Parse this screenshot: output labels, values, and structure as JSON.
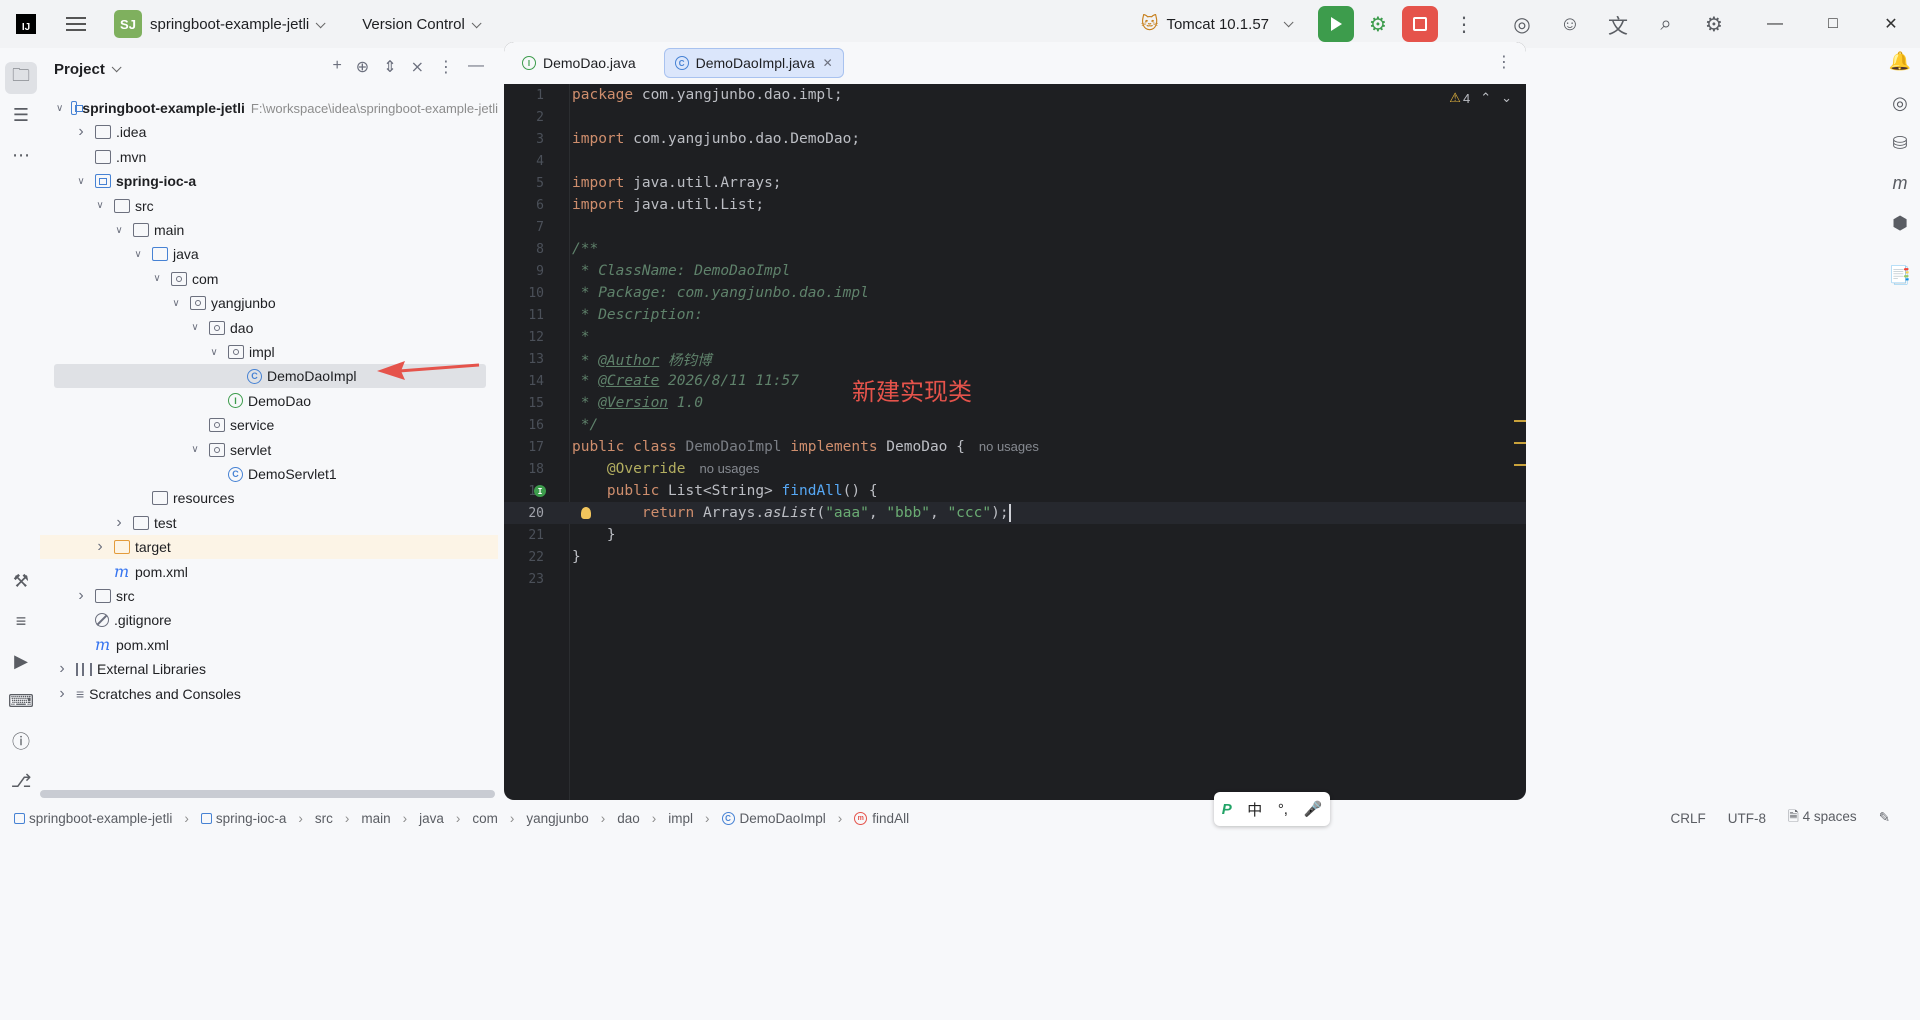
{
  "titlebar": {
    "logo": "IJ",
    "project_badge": "SJ",
    "project_name": "springboot-example-jetli",
    "vcs": "Version Control",
    "run_config": "Tomcat 10.1.57"
  },
  "project_panel": {
    "title": "Project",
    "tree": [
      {
        "label": "springboot-example-jetli",
        "hint": "F:\\workspace\\idea\\springboot-example-jetli",
        "depth": 0,
        "icon": "module",
        "toggle": "open",
        "bold": true
      },
      {
        "label": ".idea",
        "depth": 1,
        "icon": "folder",
        "toggle": "closed"
      },
      {
        "label": ".mvn",
        "depth": 1,
        "icon": "folder",
        "toggle": ""
      },
      {
        "label": "spring-ioc-a",
        "depth": 1,
        "icon": "module",
        "toggle": "open",
        "bold": true
      },
      {
        "label": "src",
        "depth": 2,
        "icon": "folder",
        "toggle": "open"
      },
      {
        "label": "main",
        "depth": 3,
        "icon": "folder",
        "toggle": "open"
      },
      {
        "label": "java",
        "depth": 4,
        "icon": "folder-blue",
        "toggle": "open"
      },
      {
        "label": "com",
        "depth": 5,
        "icon": "pkg",
        "toggle": "open"
      },
      {
        "label": "yangjunbo",
        "depth": 6,
        "icon": "pkg",
        "toggle": "open"
      },
      {
        "label": "dao",
        "depth": 7,
        "icon": "pkg",
        "toggle": "open"
      },
      {
        "label": "impl",
        "depth": 8,
        "icon": "pkg",
        "toggle": "open"
      },
      {
        "label": "DemoDaoImpl",
        "depth": 9,
        "icon": "class",
        "toggle": "",
        "selected": true
      },
      {
        "label": "DemoDao",
        "depth": 8,
        "icon": "interface",
        "toggle": ""
      },
      {
        "label": "service",
        "depth": 7,
        "icon": "pkg",
        "toggle": ""
      },
      {
        "label": "servlet",
        "depth": 7,
        "icon": "pkg",
        "toggle": "open"
      },
      {
        "label": "DemoServlet1",
        "depth": 8,
        "icon": "class",
        "toggle": ""
      },
      {
        "label": "resources",
        "depth": 4,
        "icon": "folder",
        "toggle": ""
      },
      {
        "label": "test",
        "depth": 3,
        "icon": "folder",
        "toggle": "closed"
      },
      {
        "label": "target",
        "depth": 2,
        "icon": "folder-orange",
        "toggle": "closed",
        "target": true
      },
      {
        "label": "pom.xml",
        "depth": 2,
        "icon": "maven",
        "toggle": ""
      },
      {
        "label": "src",
        "depth": 1,
        "icon": "folder",
        "toggle": "closed"
      },
      {
        "label": ".gitignore",
        "depth": 1,
        "icon": "ignore",
        "toggle": ""
      },
      {
        "label": "pom.xml",
        "depth": 1,
        "icon": "maven",
        "toggle": ""
      },
      {
        "label": "External Libraries",
        "depth": 0,
        "icon": "library",
        "toggle": "closed"
      },
      {
        "label": "Scratches and Consoles",
        "depth": 0,
        "icon": "scratch",
        "toggle": "closed"
      }
    ]
  },
  "editor": {
    "tabs": [
      {
        "label": "DemoDao.java",
        "icon": "I",
        "active": false
      },
      {
        "label": "DemoDaoImpl.java",
        "icon": "C",
        "active": true
      }
    ],
    "warnings": "4",
    "current_line": 20,
    "annotation": "新建实现类",
    "lines": {
      "l1": [
        "package",
        " com.yangjunbo.dao.impl;"
      ],
      "l3": [
        "import",
        " com.yangjunbo.dao.DemoDao;"
      ],
      "l5": [
        "import",
        " java.util.Arrays;"
      ],
      "l6": [
        "import",
        " java.util.List;"
      ],
      "l8": "/**",
      "l9": " * ClassName: DemoDaoImpl",
      "l10": " * Package: com.yangjunbo.dao.impl",
      "l11": " * Description:",
      "l12": " *",
      "l13": [
        " * ",
        "@Author",
        " 杨钧博"
      ],
      "l14": [
        " * ",
        "@Create",
        " 2026/8/11 11:57"
      ],
      "l15": [
        " * ",
        "@Version",
        " 1.0"
      ],
      "l16": " */",
      "l17": [
        "public class ",
        "DemoDaoImpl",
        " implements ",
        "DemoDao {",
        "no usages"
      ],
      "l18": [
        "    @Override",
        "no usages"
      ],
      "l19": [
        "    public ",
        "List<String> ",
        "findAll",
        "() {"
      ],
      "l20": [
        "        return ",
        "Arrays.",
        "asList",
        "(",
        "\"aaa\"",
        ", ",
        "\"bbb\"",
        ", ",
        "\"ccc\"",
        ");"
      ],
      "l21": "    }",
      "l22": "}"
    }
  },
  "statusbar": {
    "crumbs": [
      "springboot-example-jetli",
      "spring-ioc-a",
      "src",
      "main",
      "java",
      "com",
      "yangjunbo",
      "dao",
      "impl",
      "DemoDaoImpl",
      "findAll"
    ],
    "line_sep": "CRLF",
    "encoding": "UTF-8",
    "indent": "4 spaces"
  },
  "ime": {
    "mode": "中",
    "punct": "°,"
  },
  "colors": {
    "accent": "#3574f0",
    "run": "#3d9c4c",
    "stop": "#e5534b",
    "annotation": "#e5534b"
  }
}
